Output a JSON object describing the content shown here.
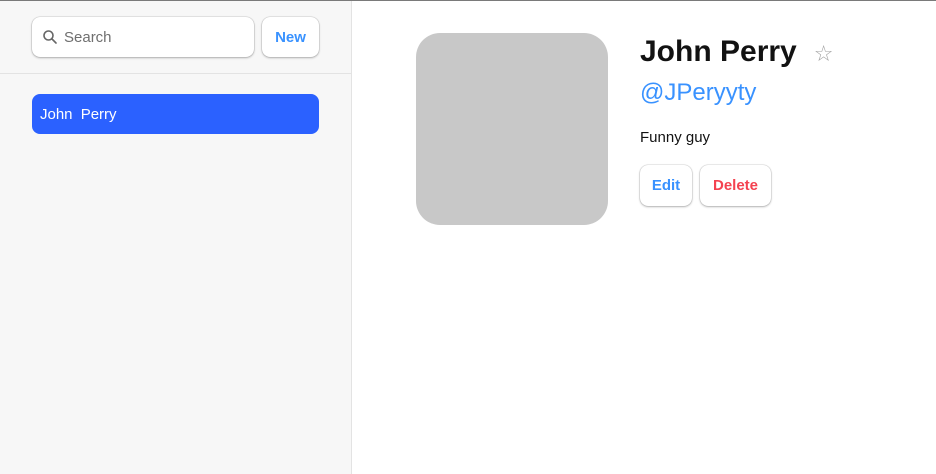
{
  "sidebar": {
    "search": {
      "placeholder": "Search",
      "value": "",
      "icon": "search-icon"
    },
    "new_label": "New",
    "contacts": [
      {
        "label": "John  Perry",
        "selected": true
      }
    ]
  },
  "contact": {
    "name": "John Perry",
    "favorite_glyph": "☆",
    "handle": "@JPeryyty",
    "notes": "Funny guy",
    "edit_label": "Edit",
    "delete_label": "Delete"
  },
  "colors": {
    "accent": "#3992ff",
    "selected_bg": "#2b61ff",
    "danger": "#f44250",
    "sidebar_bg": "#f7f7f7",
    "avatar_placeholder": "#c8c8c8"
  }
}
